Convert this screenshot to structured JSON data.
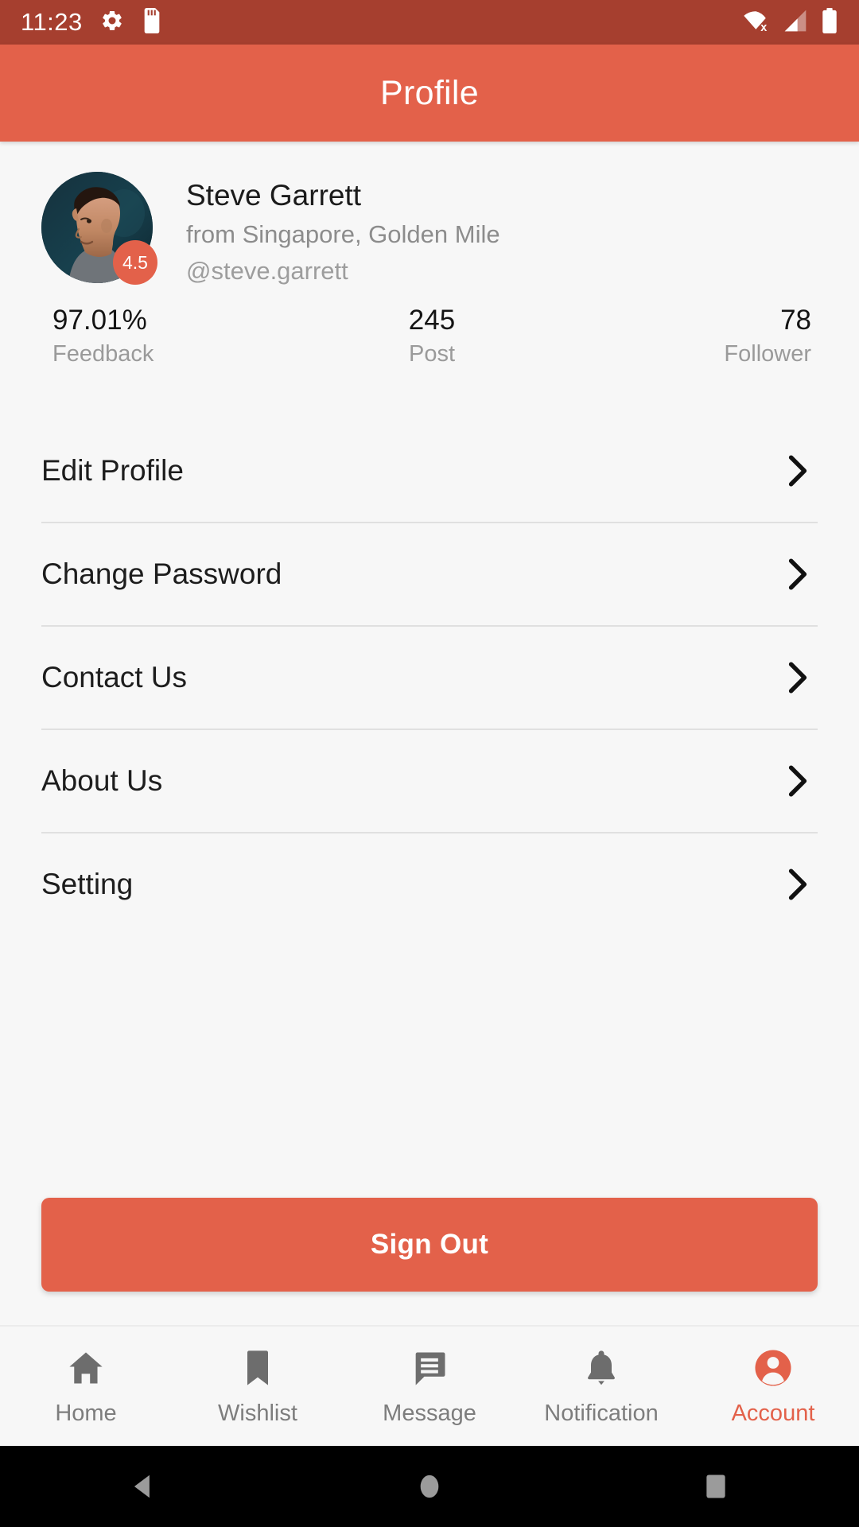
{
  "status_bar": {
    "time": "11:23",
    "icons": [
      "gear-icon",
      "sd-card-icon"
    ],
    "right_icons": [
      "wifi-off-icon",
      "cellular-signal-icon",
      "battery-full-icon"
    ],
    "background_color": "#a63f2f"
  },
  "app_bar": {
    "title": "Profile",
    "background_color": "#e3614a"
  },
  "profile": {
    "name": "Steve Garrett",
    "location": "from Singapore, Golden Mile",
    "handle": "@steve.garrett",
    "rating_badge": "4.5",
    "avatar_alt": "user-photo"
  },
  "stats": [
    {
      "value": "97.01%",
      "label": "Feedback"
    },
    {
      "value": "245",
      "label": "Post"
    },
    {
      "value": "78",
      "label": "Follower"
    }
  ],
  "menu": [
    {
      "label": "Edit Profile"
    },
    {
      "label": "Change Password"
    },
    {
      "label": "Contact Us"
    },
    {
      "label": "About Us"
    },
    {
      "label": "Setting"
    }
  ],
  "sign_out": {
    "label": "Sign Out",
    "background_color": "#e3614a"
  },
  "bottom_nav": {
    "active_color": "#e3614a",
    "inactive_color": "#7d7d7d",
    "items": [
      {
        "label": "Home",
        "icon": "home-icon",
        "active": false
      },
      {
        "label": "Wishlist",
        "icon": "bookmark-icon",
        "active": false
      },
      {
        "label": "Message",
        "icon": "chat-icon",
        "active": false
      },
      {
        "label": "Notification",
        "icon": "bell-icon",
        "active": false
      },
      {
        "label": "Account",
        "icon": "account-circle-icon",
        "active": true
      }
    ]
  },
  "android_nav": {
    "buttons": [
      "back-button",
      "home-button",
      "recents-button"
    ]
  }
}
